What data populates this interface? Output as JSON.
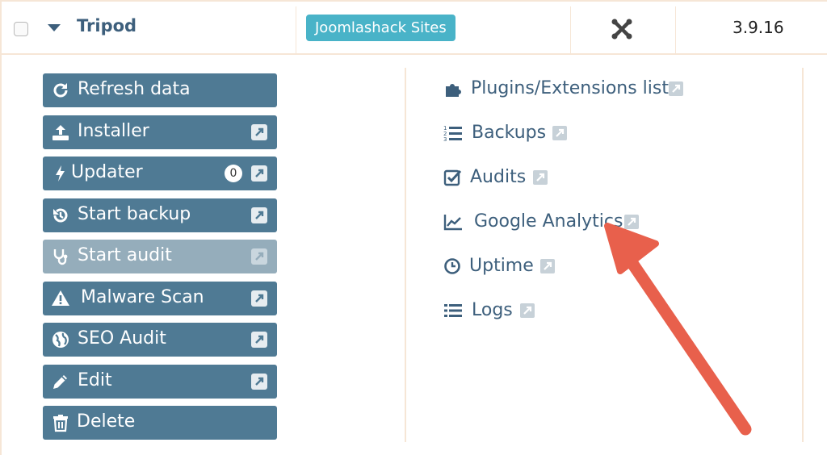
{
  "row": {
    "site_name": "Tripod",
    "group_badge": "Joomlashack Sites",
    "version": "3.9.16"
  },
  "buttons": [
    {
      "label": "Refresh data",
      "icon": "refresh-icon",
      "external": false
    },
    {
      "label": "Installer",
      "icon": "upload-icon",
      "external": true
    },
    {
      "label": "Updater",
      "icon": "bolt-icon",
      "external": true,
      "count": "0"
    },
    {
      "label": "Start backup",
      "icon": "history-icon",
      "external": true
    },
    {
      "label": "Start audit",
      "icon": "stethoscope-icon",
      "external": true,
      "disabled": true
    },
    {
      "label": "Malware Scan",
      "icon": "warning-icon",
      "external": true
    },
    {
      "label": "SEO Audit",
      "icon": "globe-icon",
      "external": true
    },
    {
      "label": "Edit",
      "icon": "pencil-icon",
      "external": true
    },
    {
      "label": "Delete",
      "icon": "trash-icon",
      "external": false
    }
  ],
  "links": [
    {
      "label": "Plugins/Extensions list",
      "icon": "puzzle-icon"
    },
    {
      "label": "Backups",
      "icon": "ordered-list-icon"
    },
    {
      "label": "Audits",
      "icon": "check-square-icon"
    },
    {
      "label": "Google Analytics",
      "icon": "line-chart-icon"
    },
    {
      "label": "Uptime",
      "icon": "clock-icon"
    },
    {
      "label": "Logs",
      "icon": "list-icon"
    }
  ],
  "colors": {
    "button_bg": "#4f7a94",
    "button_disabled_bg": "#95adbb",
    "link_color": "#3d5f7c",
    "badge_bg": "#49b3c8",
    "annotation_arrow": "#e8604c"
  }
}
